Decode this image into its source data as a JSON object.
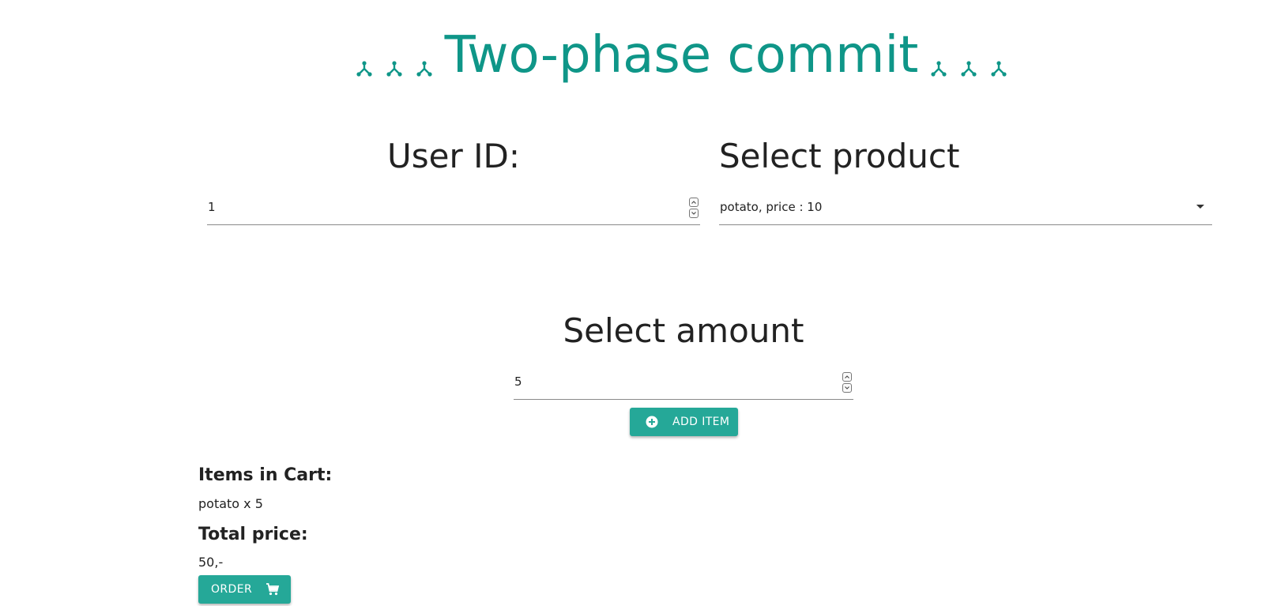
{
  "header": {
    "title": "Two-phase commit",
    "decoration_icon": "merge-icon",
    "accent_color": "#0f9688"
  },
  "user": {
    "heading": "User ID:",
    "value": "1"
  },
  "product": {
    "heading": "Select product",
    "selected": "potato, price : 10"
  },
  "amount": {
    "heading": "Select amount",
    "value": "5"
  },
  "buttons": {
    "add_item_label": "ADD ITEM",
    "add_item_icon": "add-circle-icon",
    "order_label": "ORDER",
    "order_icon": "cart-icon",
    "color": "#25a898"
  },
  "cart": {
    "heading": "Items in Cart:",
    "items": [
      "potato x 5"
    ],
    "total_heading": "Total price:",
    "total_value": "50,-"
  }
}
